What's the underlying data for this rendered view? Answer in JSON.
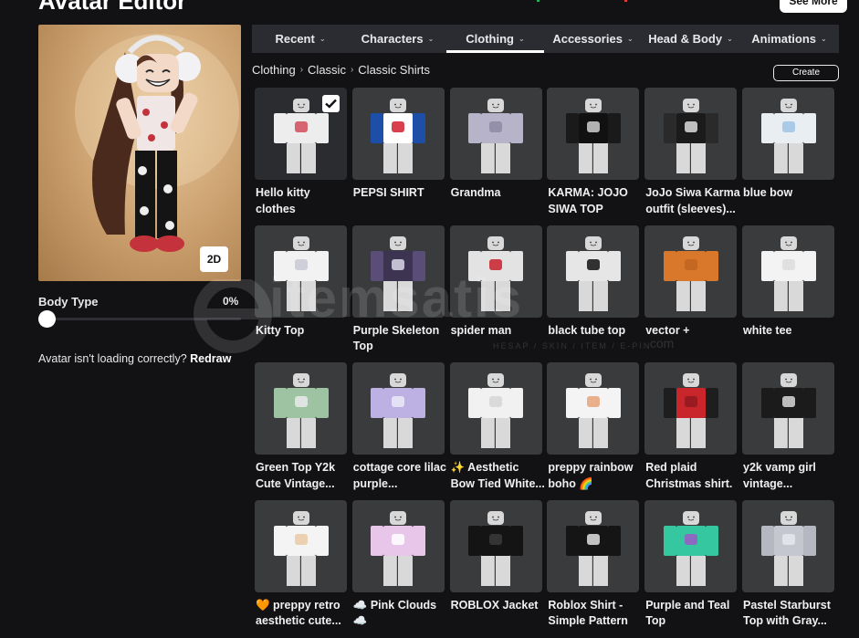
{
  "header": {
    "title": "Avatar Editor",
    "see_more_label": "See More",
    "indicator_colors": [
      "#1fb35a",
      "#e23b3b"
    ]
  },
  "avatar": {
    "toggle_2d_label": "2D",
    "body_type_label": "Body Type",
    "body_type_value": "0%",
    "body_type_fraction": 0,
    "loading_text": "Avatar isn't loading correctly?",
    "redraw_label": "Redraw"
  },
  "tabs": [
    {
      "label": "Recent",
      "active": false
    },
    {
      "label": "Characters",
      "active": false
    },
    {
      "label": "Clothing",
      "active": true
    },
    {
      "label": "Accessories",
      "active": false
    },
    {
      "label": "Head & Body",
      "active": false
    },
    {
      "label": "Animations",
      "active": false
    }
  ],
  "breadcrumb": [
    "Clothing",
    "Classic",
    "Classic Shirts"
  ],
  "create_label": "Create",
  "items": [
    {
      "name": "Hello kitty clothes",
      "shirt_color": "#ededed",
      "sleeve_color": "#ededed",
      "accent_color": "#d24b5b",
      "selected": true,
      "thumb_bg": "#2a2c30"
    },
    {
      "name": "PEPSI SHIRT",
      "shirt_color": "#ffffff",
      "sleeve_color": "#1d4ea8",
      "accent_color": "#d11f2e",
      "selected": false
    },
    {
      "name": "Grandma",
      "shirt_color": "#b7b3c9",
      "sleeve_color": "#b7b3c9",
      "accent_color": "#8f8aa3",
      "selected": false
    },
    {
      "name": "KARMA: JOJO SIWA TOP",
      "shirt_color": "#111111",
      "sleeve_color": "#1a1a1a",
      "accent_color": "#cfcfcf",
      "selected": false
    },
    {
      "name": "JoJo Siwa Karma outfit (sleeves)...",
      "shirt_color": "#1b1b1b",
      "sleeve_color": "#2a2a2a",
      "accent_color": "#dcdcdc",
      "selected": false
    },
    {
      "name": "blue bow",
      "shirt_color": "#e9eef2",
      "sleeve_color": "#e9eef2",
      "accent_color": "#9fc4e6",
      "selected": false
    },
    {
      "name": "Kitty Top",
      "shirt_color": "#f2f2f2",
      "sleeve_color": "#f2f2f2",
      "accent_color": "#c9c9d6",
      "selected": false
    },
    {
      "name": "Purple Skeleton Top",
      "shirt_color": "#3c3450",
      "sleeve_color": "#5a4d78",
      "accent_color": "#d8d8e8",
      "selected": false
    },
    {
      "name": "spider man",
      "shirt_color": "#e3e3e3",
      "sleeve_color": "#e3e3e3",
      "accent_color": "#c8202c",
      "selected": false
    },
    {
      "name": "black tube top",
      "shirt_color": "#e6e6e6",
      "sleeve_color": "#e6e6e6",
      "accent_color": "#111111",
      "selected": false
    },
    {
      "name": "vector +",
      "shirt_color": "#d9782a",
      "sleeve_color": "#d9782a",
      "accent_color": "#c06520",
      "selected": false
    },
    {
      "name": "white tee",
      "shirt_color": "#f3f3f3",
      "sleeve_color": "#f3f3f3",
      "accent_color": "#dcdcdc",
      "selected": false
    },
    {
      "name": "Green Top Y2k Cute Vintage...",
      "shirt_color": "#9dc3a3",
      "sleeve_color": "#9dc3a3",
      "accent_color": "#eaeaea",
      "selected": false
    },
    {
      "name": "cottage core lilac purple...",
      "shirt_color": "#bdb0e2",
      "sleeve_color": "#bdb0e2",
      "accent_color": "#eaeaf6",
      "selected": false
    },
    {
      "name": "✨ Aesthetic Bow Tied White...",
      "shirt_color": "#f1f1f1",
      "sleeve_color": "#f1f1f1",
      "accent_color": "#d6d6d6",
      "selected": false
    },
    {
      "name": "preppy rainbow boho 🌈",
      "shirt_color": "#f4f4f4",
      "sleeve_color": "#f4f4f4",
      "accent_color": "#e7a27a",
      "selected": false
    },
    {
      "name": "Red plaid Christmas shirt.",
      "shirt_color": "#c8262b",
      "sleeve_color": "#1e1e1e",
      "accent_color": "#8e1a1e",
      "selected": false
    },
    {
      "name": "y2k vamp girl vintage...",
      "shirt_color": "#1b1b1b",
      "sleeve_color": "#1b1b1b",
      "accent_color": "#d8d8d8",
      "selected": false
    },
    {
      "name": "🧡 preppy retro aesthetic cute...",
      "shirt_color": "#f4f4f4",
      "sleeve_color": "#f4f4f4",
      "accent_color": "#e9c9a5",
      "selected": false
    },
    {
      "name": "☁️ Pink Clouds ☁️",
      "shirt_color": "#e7c6ea",
      "sleeve_color": "#e7c6ea",
      "accent_color": "#ffffff",
      "selected": false
    },
    {
      "name": "ROBLOX Jacket",
      "shirt_color": "#141414",
      "sleeve_color": "#141414",
      "accent_color": "#3a3a3a",
      "selected": false
    },
    {
      "name": "Roblox Shirt - Simple Pattern",
      "shirt_color": "#151515",
      "sleeve_color": "#151515",
      "accent_color": "#e0e0e0",
      "selected": false
    },
    {
      "name": "Purple and Teal Top",
      "shirt_color": "#35c7a0",
      "sleeve_color": "#35c7a0",
      "accent_color": "#9b59c8",
      "selected": false
    },
    {
      "name": "Pastel Starburst Top with Gray...",
      "shirt_color": "#c4c7cf",
      "sleeve_color": "#b5b8c1",
      "accent_color": "#e8e8ee",
      "selected": false
    }
  ],
  "watermark": {
    "main": "itemsatis",
    "sub": "HESAP / SKIN / ITEM / E-PIN",
    "com": ".com"
  }
}
